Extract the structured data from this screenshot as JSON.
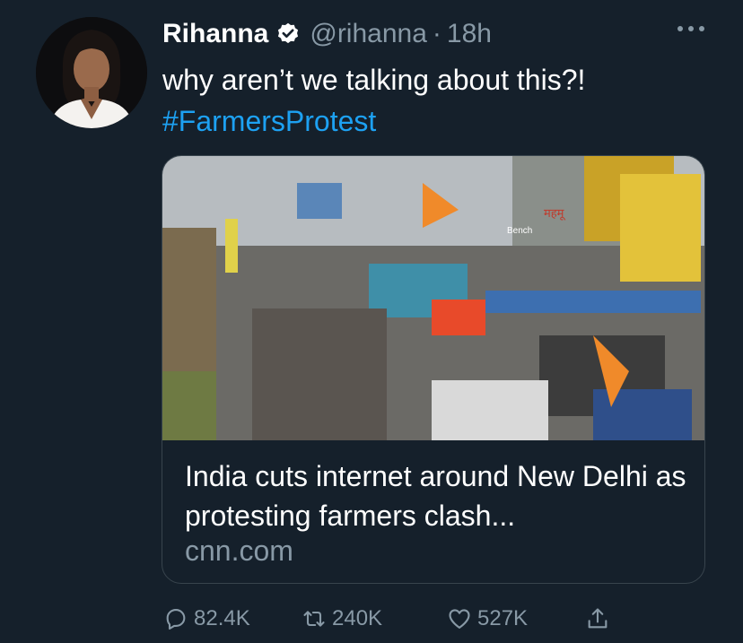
{
  "tweet": {
    "author_name": "Rihanna",
    "handle": "@rihanna",
    "separator": "·",
    "time": "18h",
    "text": "why aren’t we talking about this?!",
    "hashtag": "#FarmersProtest"
  },
  "card": {
    "title": "India cuts internet around New Delhi as protesting farmers clash...",
    "domain": "cnn.com",
    "image_text": {
      "sign_1": "Bench",
      "sign_2": "महमू"
    }
  },
  "actions": {
    "replies": "82.4K",
    "retweets": "240K",
    "likes": "527K"
  },
  "icons": {
    "verified": "verified-badge-icon",
    "more": "more-options-icon",
    "reply": "reply-icon",
    "retweet": "retweet-icon",
    "like": "heart-icon",
    "share": "share-icon"
  },
  "colors": {
    "background": "#15202b",
    "text": "#ffffff",
    "secondary": "#8899a6",
    "link": "#1da1f2",
    "border": "#38444d"
  }
}
